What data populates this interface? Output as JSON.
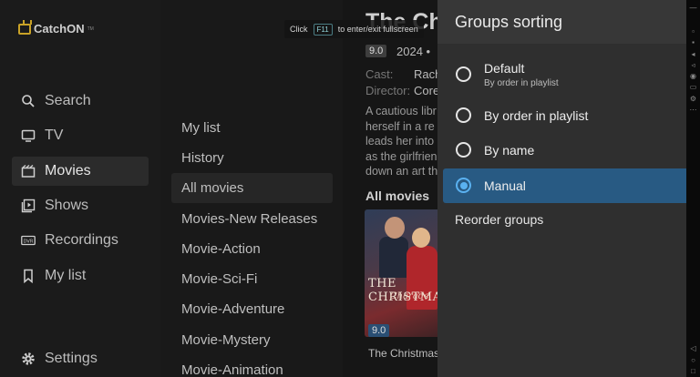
{
  "app": {
    "logo_text": "CatchON",
    "logo_tm": "TM"
  },
  "sidebar": {
    "items": [
      {
        "label": "Search",
        "icon": "search-icon"
      },
      {
        "label": "TV",
        "icon": "tv-icon"
      },
      {
        "label": "Movies",
        "icon": "movie-icon",
        "active": true
      },
      {
        "label": "Shows",
        "icon": "shows-icon"
      },
      {
        "label": "Recordings",
        "icon": "dvr-icon"
      },
      {
        "label": "My list",
        "icon": "bookmark-icon"
      }
    ],
    "settings_label": "Settings"
  },
  "categories": {
    "items": [
      "My list",
      "History",
      "All movies",
      "Movies-New Releases",
      "Movie-Action",
      "Movie-Sci-Fi",
      "Movie-Adventure",
      "Movie-Mystery",
      "Movie-Animation"
    ],
    "active_index": 2
  },
  "detail": {
    "title": "The Ch",
    "rating": "9.0",
    "year": "2024",
    "separator": "•",
    "cast_label": "Cast:",
    "cast_value": "Rach",
    "director_label": "Director:",
    "director_value": "Core",
    "description_lines": [
      "A cautious libr",
      "herself in a re",
      "leads her into",
      "as the girlfrien",
      "down an art th"
    ],
    "section_title": "All movies",
    "poster": {
      "title": "THE CHRISTMAS",
      "subtitle": "Charade",
      "rating": "9.0",
      "caption": "The Christmas"
    }
  },
  "fullscreen_hint": {
    "prefix": "Click",
    "key": "F11",
    "suffix": "to enter/exit fullscreen"
  },
  "groups_sorting": {
    "title": "Groups sorting",
    "options": [
      {
        "label": "Default",
        "sublabel": "By order in playlist",
        "selected": false
      },
      {
        "label": "By order in playlist",
        "selected": false
      },
      {
        "label": "By name",
        "selected": false
      },
      {
        "label": "Manual",
        "selected": true
      }
    ],
    "reorder_label": "Reorder groups"
  },
  "colors": {
    "accent": "#285a83",
    "radio_accent": "#5ab1f0",
    "logo": "#c9a227"
  }
}
